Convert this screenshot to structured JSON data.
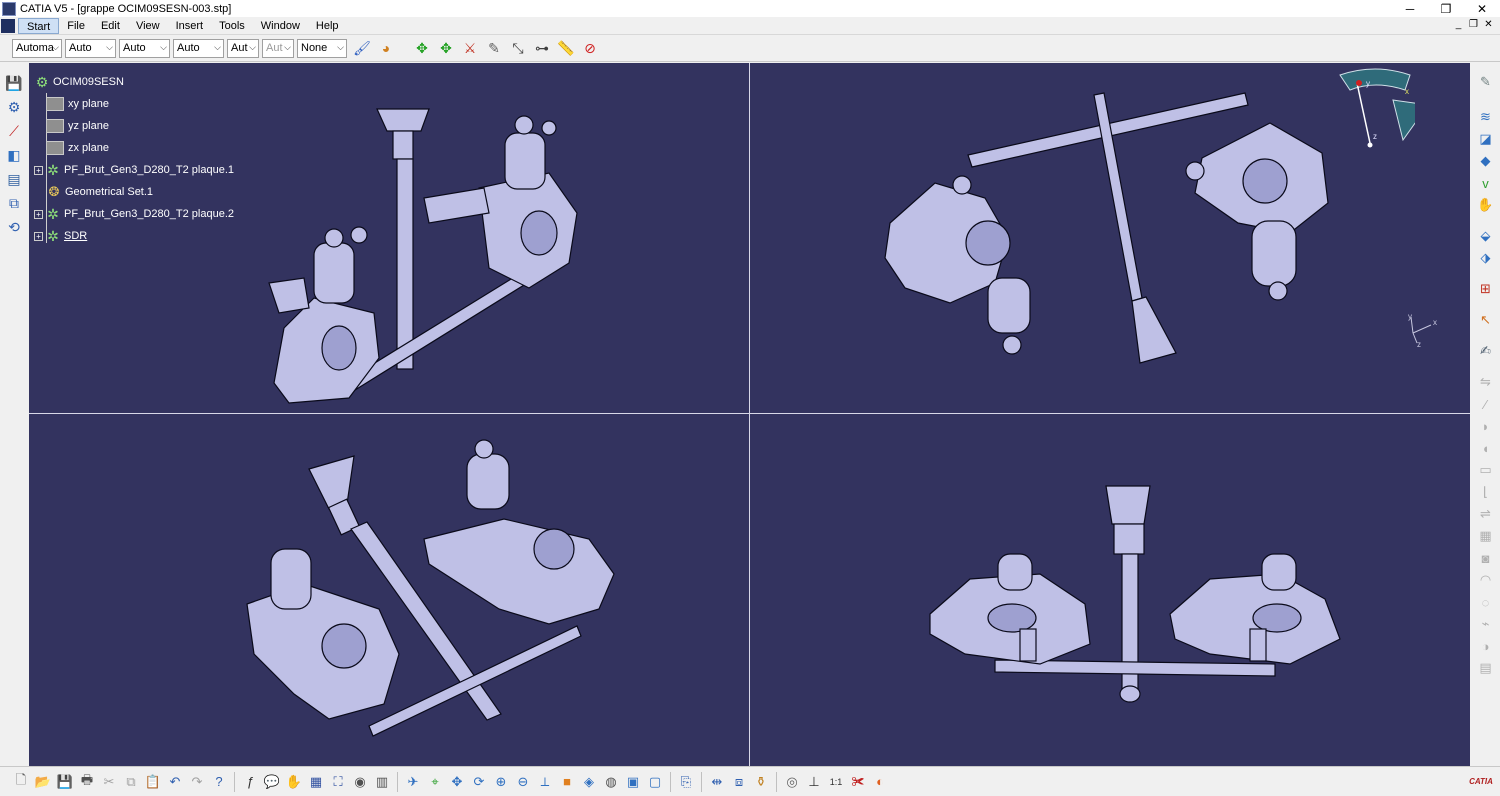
{
  "window": {
    "title": "CATIA V5 - [grappe OCIM09SESN-003.stp]",
    "controls": [
      "minimize-icon",
      "restore-icon",
      "close-icon"
    ]
  },
  "menubar": {
    "items": [
      "Start",
      "File",
      "Edit",
      "View",
      "Insert",
      "Tools",
      "Window",
      "Help"
    ],
    "active": "Start"
  },
  "toolbar": {
    "combos": [
      {
        "value": "Automa",
        "disabled": false
      },
      {
        "value": "Auto",
        "disabled": false
      },
      {
        "value": "Auto",
        "disabled": false
      },
      {
        "value": "Auto",
        "disabled": false
      },
      {
        "value": "Aut",
        "disabled": false
      },
      {
        "value": "Aut",
        "disabled": true
      },
      {
        "value": "None",
        "disabled": false
      }
    ],
    "icons": [
      "painter-icon",
      "apply-material-icon",
      "move-icon",
      "rotate-icon",
      "snap-icon",
      "measure-icon",
      "split-icon",
      "section-icon",
      "ruler-icon",
      "clash-icon"
    ]
  },
  "spec_tree": {
    "root": "OCIM09SESN",
    "children": [
      {
        "label": "xy plane",
        "icon": "plane-icon"
      },
      {
        "label": "yz plane",
        "icon": "plane-icon"
      },
      {
        "label": "zx plane",
        "icon": "plane-icon"
      },
      {
        "label": "PF_Brut_Gen3_D280_T2 plaque.1",
        "icon": "part-gear-icon"
      },
      {
        "label": "Geometrical Set.1",
        "icon": "geometrical-set-icon"
      },
      {
        "label": "PF_Brut_Gen3_D280_T2 plaque.2",
        "icon": "part-gear-icon"
      },
      {
        "label": "SDR",
        "icon": "part-gear-icon"
      }
    ]
  },
  "compass": {
    "x": "x",
    "y": "y",
    "z": "z"
  },
  "axis_triad": {
    "x": "x",
    "y": "y",
    "z": "z"
  },
  "brand": "CATIA",
  "colors": {
    "viewport_bg": "#33335f",
    "part_fill": "#bfc0e6",
    "part_edge": "#0a0a1a",
    "chrome_bg": "#f0f0f0"
  }
}
